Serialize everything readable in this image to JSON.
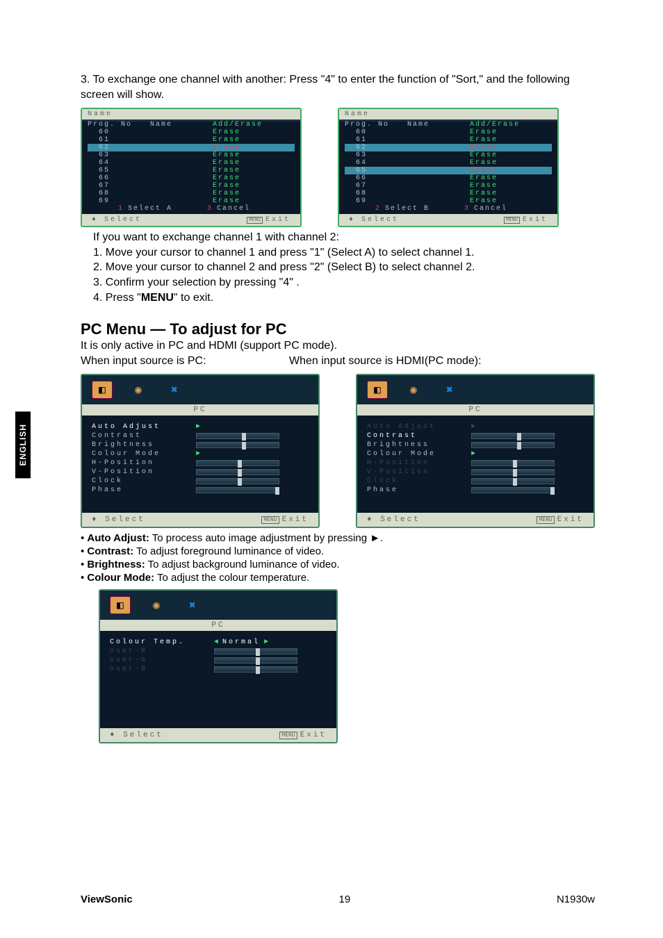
{
  "sideTab": "ENGLISH",
  "intro": "3. To exchange one channel with another: Press \"4\" to enter the function of \"Sort,\" and the following screen will show.",
  "nameScreens": [
    {
      "title": "Name",
      "header": {
        "c1": "Prog. No",
        "c2": "Name",
        "c3": "Add/Erase"
      },
      "rows": [
        {
          "no": "60",
          "c3": "Erase",
          "hl": false
        },
        {
          "no": "61",
          "c3": "Erase",
          "hl": false
        },
        {
          "no": "62",
          "c3": "Erase",
          "hl": true
        },
        {
          "no": "63",
          "c3": "Erase",
          "hl": false
        },
        {
          "no": "64",
          "c3": "Erase",
          "hl": false
        },
        {
          "no": "65",
          "c3": "Erase",
          "hl": false
        },
        {
          "no": "66",
          "c3": "Erase",
          "hl": false
        },
        {
          "no": "67",
          "c3": "Erase",
          "hl": false
        },
        {
          "no": "68",
          "c3": "Erase",
          "hl": false
        },
        {
          "no": "69",
          "c3": "Erase",
          "hl": false
        }
      ],
      "foot": {
        "n1": "1",
        "t1": "Select A",
        "n2": "3",
        "t2": "Cancel"
      },
      "bar": {
        "left": "Select",
        "rightBox": "MENU",
        "right": "Exit"
      }
    },
    {
      "title": "Name",
      "header": {
        "c1": "Prog. No",
        "c2": "Name",
        "c3": "Add/Erase"
      },
      "rows": [
        {
          "no": "60",
          "c3": "Erase",
          "hl": false
        },
        {
          "no": "61",
          "c3": "Erase",
          "hl": false
        },
        {
          "no": "62",
          "c3": "Erase",
          "hl": true
        },
        {
          "no": "63",
          "c3": "Erase",
          "hl": false
        },
        {
          "no": "64",
          "c3": "Erase",
          "hl": false
        },
        {
          "no": "65",
          "c3": "Erase",
          "hl": true
        },
        {
          "no": "66",
          "c3": "Erase",
          "hl": false
        },
        {
          "no": "67",
          "c3": "Erase",
          "hl": false
        },
        {
          "no": "68",
          "c3": "Erase",
          "hl": false
        },
        {
          "no": "69",
          "c3": "Erase",
          "hl": false
        }
      ],
      "foot": {
        "n1": "2",
        "t1": "Select B",
        "n2": "3",
        "t2": "Cancel"
      },
      "bar": {
        "left": "Select",
        "rightBox": "MENU",
        "right": "Exit"
      }
    }
  ],
  "exchangeSteps": {
    "intro": "If you want to exchange channel 1 with channel 2:",
    "s1": "1. Move your cursor to channel 1 and press \"1\" (Select A) to select channel 1.",
    "s2": "2. Move your cursor to channel 2 and press \"2\" (Select B) to select channel 2.",
    "s3": "3. Confirm your selection by pressing \"4\" .",
    "s4a": "4. Press \"",
    "s4b": "MENU",
    "s4c": "\" to exit."
  },
  "pcHeading": "PC Menu — To adjust for PC",
  "pcIntro": "It is only active in PC and HDMI (support PC mode).",
  "pcLabelLeft": "When input source is PC:",
  "pcLabelRight": "When input source is HDMI(PC mode):",
  "pcMenu": {
    "title": "PC",
    "rows": [
      {
        "label": "Auto Adjust",
        "type": "arrow",
        "sel": true,
        "dim": false
      },
      {
        "label": "Contrast",
        "type": "slider",
        "val": 55,
        "dim": false
      },
      {
        "label": "Brightness",
        "type": "slider",
        "val": 55,
        "dim": false
      },
      {
        "label": "Colour Mode",
        "type": "arrow",
        "dim": false
      },
      {
        "label": "H-Position",
        "type": "slider",
        "val": 50,
        "dim": false
      },
      {
        "label": "V-Position",
        "type": "slider",
        "val": 50,
        "dim": false
      },
      {
        "label": "Clock",
        "type": "slider",
        "val": 50,
        "dim": false
      },
      {
        "label": "Phase",
        "type": "slider",
        "val": 96,
        "dim": false
      }
    ],
    "bar": {
      "left": "Select",
      "rightBox": "MENU",
      "right": "Exit"
    }
  },
  "pcMenuHdmi": {
    "title": "PC",
    "rows": [
      {
        "label": "Auto Adjust",
        "type": "arrow",
        "sel": false,
        "dim": true
      },
      {
        "label": "Contrast",
        "type": "slider",
        "val": 55,
        "sel": true,
        "dim": false
      },
      {
        "label": "Brightness",
        "type": "slider",
        "val": 55,
        "dim": false
      },
      {
        "label": "Colour Mode",
        "type": "arrow",
        "dim": false
      },
      {
        "label": "H-Position",
        "type": "slider",
        "val": 50,
        "dim": true
      },
      {
        "label": "V-Position",
        "type": "slider",
        "val": 50,
        "dim": true
      },
      {
        "label": "Clock",
        "type": "slider",
        "val": 50,
        "dim": true
      },
      {
        "label": "Phase",
        "type": "slider",
        "val": 96,
        "dim": false
      }
    ],
    "bar": {
      "left": "Select",
      "rightBox": "MENU",
      "right": "Exit"
    }
  },
  "bullets": [
    {
      "b": "Auto Adjust:",
      "t": " To process auto image adjustment by pressing ►."
    },
    {
      "b": "Contrast:",
      "t": " To adjust foreground luminance of video."
    },
    {
      "b": "Brightness:",
      "t": " To adjust background luminance of video."
    },
    {
      "b": "Colour Mode:",
      "t": " To adjust the colour temperature."
    }
  ],
  "colourMenu": {
    "title": "PC",
    "rows": [
      {
        "label": "Colour Temp.",
        "type": "lr",
        "value": "Normal",
        "sel": true
      },
      {
        "label": "User-R",
        "type": "slider",
        "val": 50,
        "dim": true
      },
      {
        "label": "User-G",
        "type": "slider",
        "val": 50,
        "dim": true
      },
      {
        "label": "User-B",
        "type": "slider",
        "val": 50,
        "dim": true
      }
    ],
    "bar": {
      "left": "Select",
      "rightBox": "MENU",
      "right": "Exit"
    }
  },
  "footer": {
    "left": "ViewSonic",
    "center": "19",
    "right": "N1930w"
  }
}
